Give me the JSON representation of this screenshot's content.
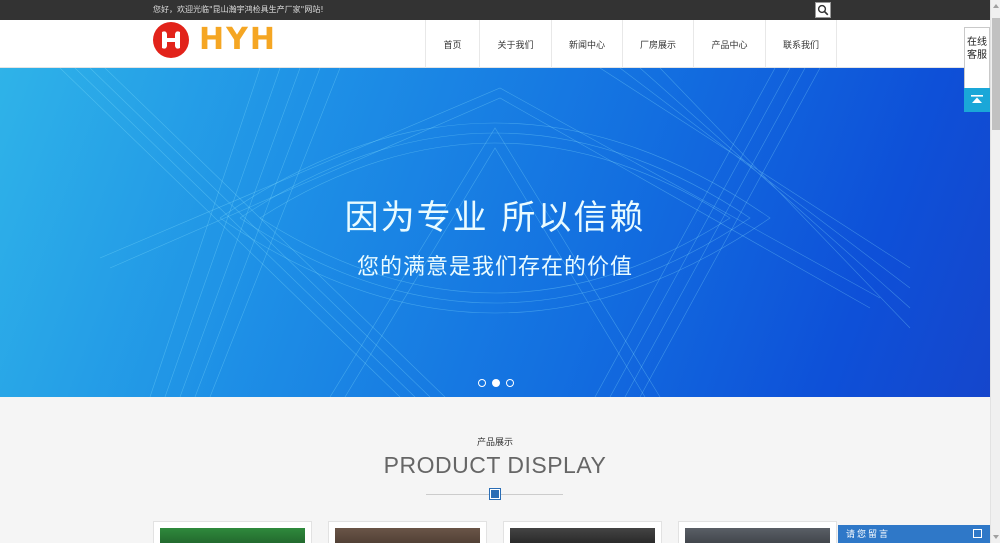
{
  "topbar": {
    "welcome_text": "您好，欢迎光临\"昆山瀚宇鸿检具生产厂家\"网站!",
    "search_icon": "search-icon"
  },
  "header": {
    "logo_text": "HYH",
    "logo_color": "#f5a623",
    "logo_mark_color": "#e2231a",
    "nav": [
      {
        "label": "首页"
      },
      {
        "label": "关于我们"
      },
      {
        "label": "新闻中心"
      },
      {
        "label": "厂房展示"
      },
      {
        "label": "产品中心"
      },
      {
        "label": "联系我们"
      }
    ]
  },
  "banner": {
    "headline": "因为专业  所以信赖",
    "subline": "您的满意是我们存在的价值",
    "slides_total": 3,
    "active_slide": 2
  },
  "products": {
    "title_cn": "产品展示",
    "title_en": "PRODUCT DISPLAY",
    "card_count": 4
  },
  "float_service": {
    "label": "在线客服",
    "top_icon": "back-to-top-icon",
    "accent": "#1aa7d8"
  },
  "leave_message": {
    "label": "请您留言",
    "accent": "#2f78c8"
  }
}
